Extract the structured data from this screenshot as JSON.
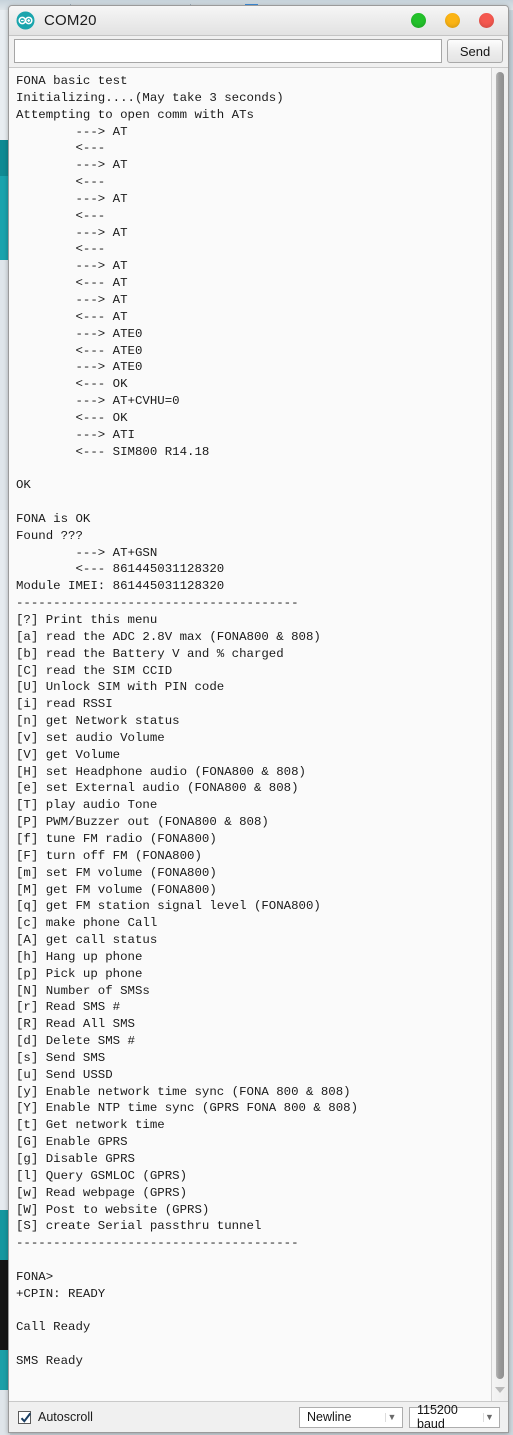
{
  "window": {
    "title": "COM20",
    "app_icon": "arduino-infinity-icon",
    "buttons": [
      {
        "name": "minimize",
        "color": "#23c12b"
      },
      {
        "name": "maximize",
        "color": "#fbb415"
      },
      {
        "name": "close",
        "color": "#f4584f"
      }
    ]
  },
  "send_row": {
    "input_value": "",
    "input_placeholder": "",
    "send_label": "Send"
  },
  "console": {
    "lines": [
      "FONA basic test",
      "Initializing....(May take 3 seconds)",
      "Attempting to open comm with ATs",
      "        ---> AT",
      "        <---",
      "        ---> AT",
      "        <---",
      "        ---> AT",
      "        <---",
      "        ---> AT",
      "        <---",
      "        ---> AT",
      "        <--- AT",
      "        ---> AT",
      "        <--- AT",
      "        ---> ATE0",
      "        <--- ATE0",
      "        ---> ATE0",
      "        <--- OK",
      "        ---> AT+CVHU=0",
      "        <--- OK",
      "        ---> ATI",
      "        <--- SIM800 R14.18",
      "",
      "OK",
      "",
      "FONA is OK",
      "Found ???",
      "        ---> AT+GSN",
      "        <--- 861445031128320",
      "Module IMEI: 861445031128320",
      "--------------------------------------",
      "[?] Print this menu",
      "[a] read the ADC 2.8V max (FONA800 & 808)",
      "[b] read the Battery V and % charged",
      "[C] read the SIM CCID",
      "[U] Unlock SIM with PIN code",
      "[i] read RSSI",
      "[n] get Network status",
      "[v] set audio Volume",
      "[V] get Volume",
      "[H] set Headphone audio (FONA800 & 808)",
      "[e] set External audio (FONA800 & 808)",
      "[T] play audio Tone",
      "[P] PWM/Buzzer out (FONA800 & 808)",
      "[f] tune FM radio (FONA800)",
      "[F] turn off FM (FONA800)",
      "[m] set FM volume (FONA800)",
      "[M] get FM volume (FONA800)",
      "[q] get FM station signal level (FONA800)",
      "[c] make phone Call",
      "[A] get call status",
      "[h] Hang up phone",
      "[p] Pick up phone",
      "[N] Number of SMSs",
      "[r] Read SMS #",
      "[R] Read All SMS",
      "[d] Delete SMS #",
      "[s] Send SMS",
      "[u] Send USSD",
      "[y] Enable network time sync (FONA 800 & 808)",
      "[Y] Enable NTP time sync (GPRS FONA 800 & 808)",
      "[t] Get network time",
      "[G] Enable GPRS",
      "[g] Disable GPRS",
      "[l] Query GSMLOC (GPRS)",
      "[w] Read webpage (GPRS)",
      "[W] Post to website (GPRS)",
      "[S] create Serial passthru tunnel",
      "--------------------------------------",
      "",
      "FONA>",
      "+CPIN: READY",
      "",
      "Call Ready",
      "",
      "SMS Ready"
    ]
  },
  "statusbar": {
    "autoscroll_label": "Autoscroll",
    "autoscroll_checked": true,
    "line_ending": "Newline",
    "baud_rate": "115200 baud"
  }
}
